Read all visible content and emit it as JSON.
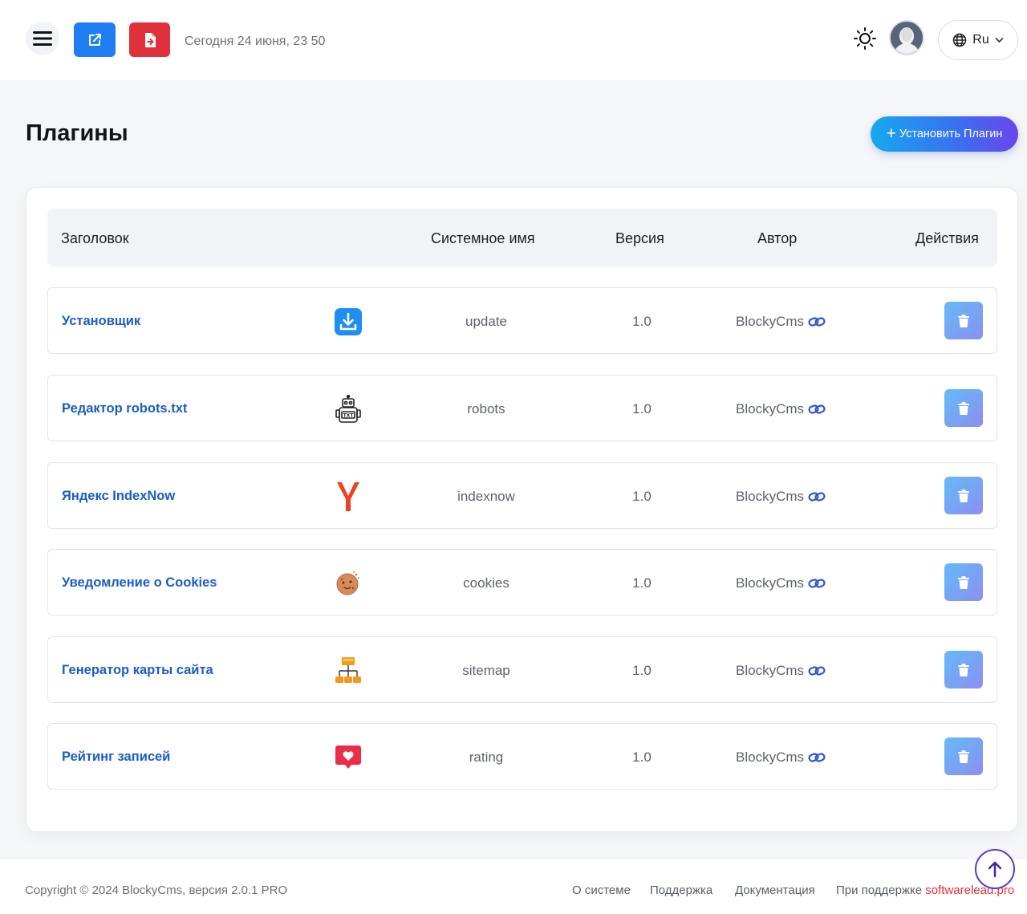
{
  "header": {
    "datetime": "Сегодня 24 июня, 23 50",
    "language": "Ru"
  },
  "page": {
    "title": "Плагины",
    "install_button": "Установить Плагин"
  },
  "table": {
    "columns": [
      "Заголовок",
      "Системное имя",
      "Версия",
      "Автор",
      "Действия"
    ],
    "rows": [
      {
        "title": "Установщик",
        "system_name": "update",
        "version": "1.0",
        "author": "BlockyCms",
        "icon": "download-icon"
      },
      {
        "title": "Редактор robots.txt",
        "system_name": "robots",
        "version": "1.0",
        "author": "BlockyCms",
        "icon": "robot-icon"
      },
      {
        "title": "Яндекс IndexNow",
        "system_name": "indexnow",
        "version": "1.0",
        "author": "BlockyCms",
        "icon": "yandex-icon"
      },
      {
        "title": "Уведомление о Cookies",
        "system_name": "cookies",
        "version": "1.0",
        "author": "BlockyCms",
        "icon": "cookie-icon"
      },
      {
        "title": "Генератор карты сайта",
        "system_name": "sitemap",
        "version": "1.0",
        "author": "BlockyCms",
        "icon": "sitemap-icon"
      },
      {
        "title": "Рейтинг записей",
        "system_name": "rating",
        "version": "1.0",
        "author": "BlockyCms",
        "icon": "heart-icon"
      }
    ]
  },
  "footer": {
    "copyright": "Copyright © 2024 BlockyCms, версия 2.0.1 PRO",
    "links": [
      "О системе",
      "Поддержка",
      "Документация"
    ],
    "support_prefix": "При поддержке",
    "support_brand": "softwarelead.pro"
  },
  "colors": {
    "primary": "#1f7ff2",
    "danger": "#e0303c",
    "link": "#1a5cc8",
    "page_bg": "#f5f6f8"
  }
}
